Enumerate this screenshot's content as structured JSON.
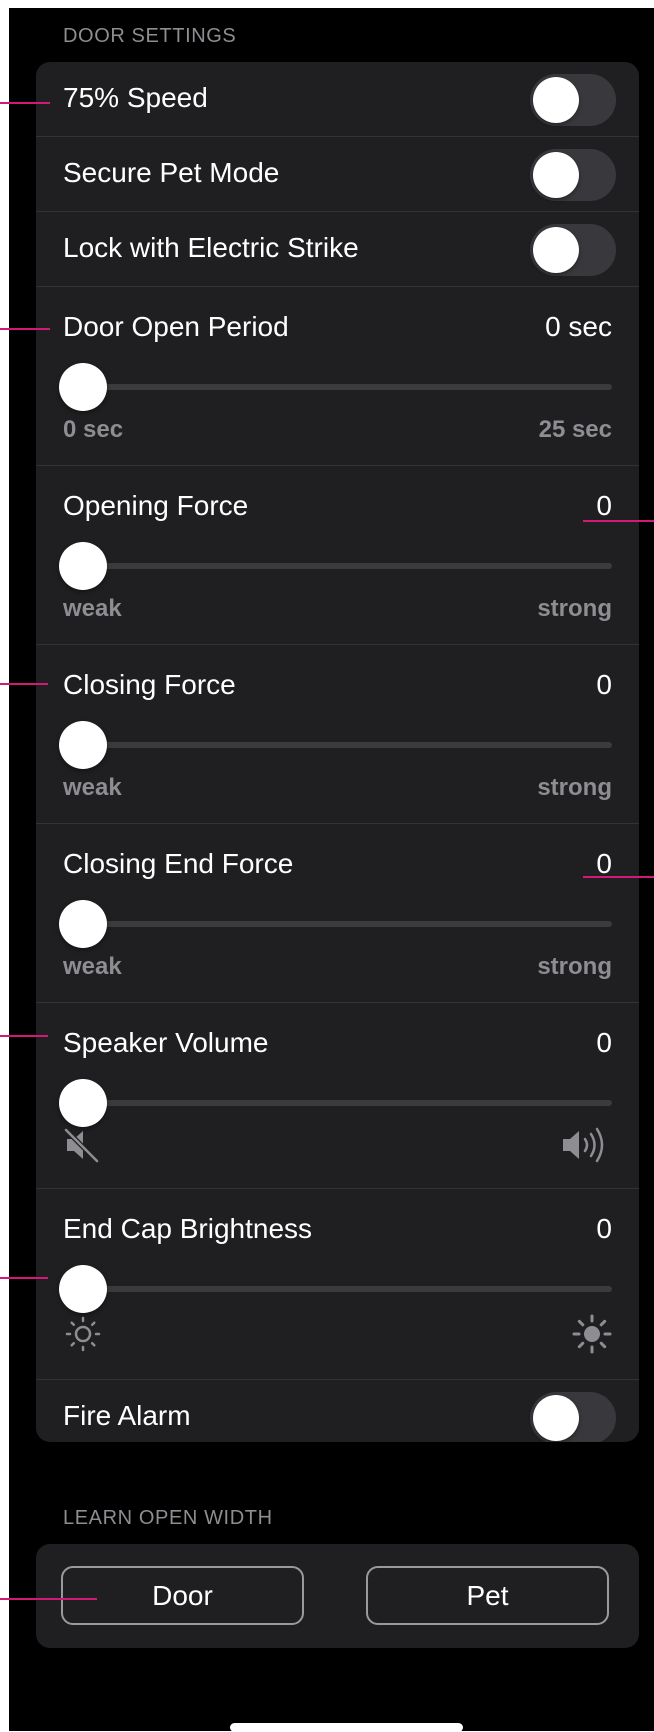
{
  "sections": {
    "door_settings": "DOOR SETTINGS",
    "learn_open_width": "LEARN OPEN WIDTH"
  },
  "toggles": {
    "speed_75": {
      "label": "75% Speed",
      "on": false
    },
    "secure_pet_mode": {
      "label": "Secure Pet Mode",
      "on": false
    },
    "electric_strike": {
      "label": "Lock with Electric Strike",
      "on": false
    },
    "fire_alarm": {
      "label": "Fire Alarm",
      "on": false
    }
  },
  "sliders": {
    "door_open_period": {
      "label": "Door Open Period",
      "value": "0 sec",
      "min_label": "0 sec",
      "max_label": "25 sec",
      "level": 0
    },
    "opening_force": {
      "label": "Opening Force",
      "value": "0",
      "min_label": "weak",
      "max_label": "strong",
      "level": 0
    },
    "closing_force": {
      "label": "Closing Force",
      "value": "0",
      "min_label": "weak",
      "max_label": "strong",
      "level": 0
    },
    "closing_end_force": {
      "label": "Closing End Force",
      "value": "0",
      "min_label": "weak",
      "max_label": "strong",
      "level": 0
    },
    "speaker_volume": {
      "label": "Speaker Volume",
      "value": "0",
      "min_icon": "speaker-muted-icon",
      "max_icon": "speaker-loud-icon",
      "level": 0
    },
    "end_cap_brightness": {
      "label": "End Cap Brightness",
      "value": "0",
      "min_icon": "brightness-low-icon",
      "max_icon": "brightness-high-icon",
      "level": 0
    }
  },
  "buttons": {
    "door": "Door",
    "pet": "Pet"
  },
  "colors": {
    "background": "#000000",
    "card": "#1f1f21",
    "callout": "#d6177a",
    "secondary_text": "#8d8d92"
  }
}
